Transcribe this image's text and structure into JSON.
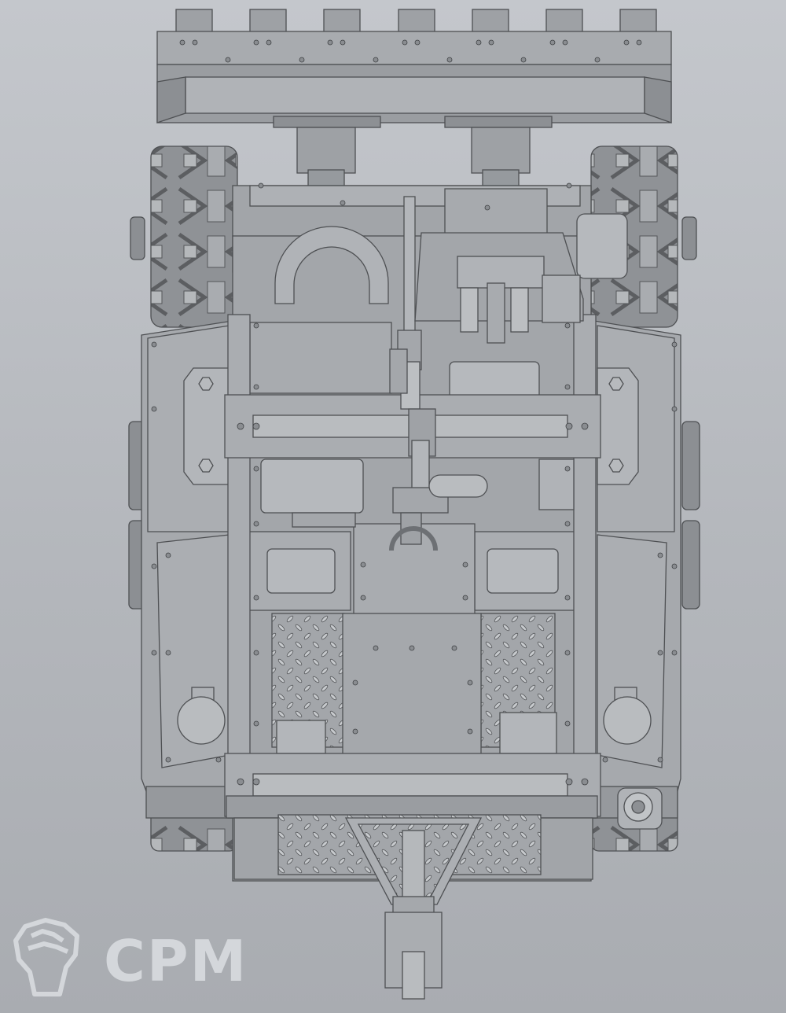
{
  "watermark": {
    "text": "CPM",
    "logo_icon": "raised-fist-icon"
  },
  "colors": {
    "background_top": "#c4c7cc",
    "background_bottom": "#a9acb1",
    "metal_face": "#9ea1a5",
    "metal_light": "#b3b6ba",
    "metal_dark": "#7c7f83",
    "outline": "#4e5053",
    "watermark": "#eef0f3"
  }
}
